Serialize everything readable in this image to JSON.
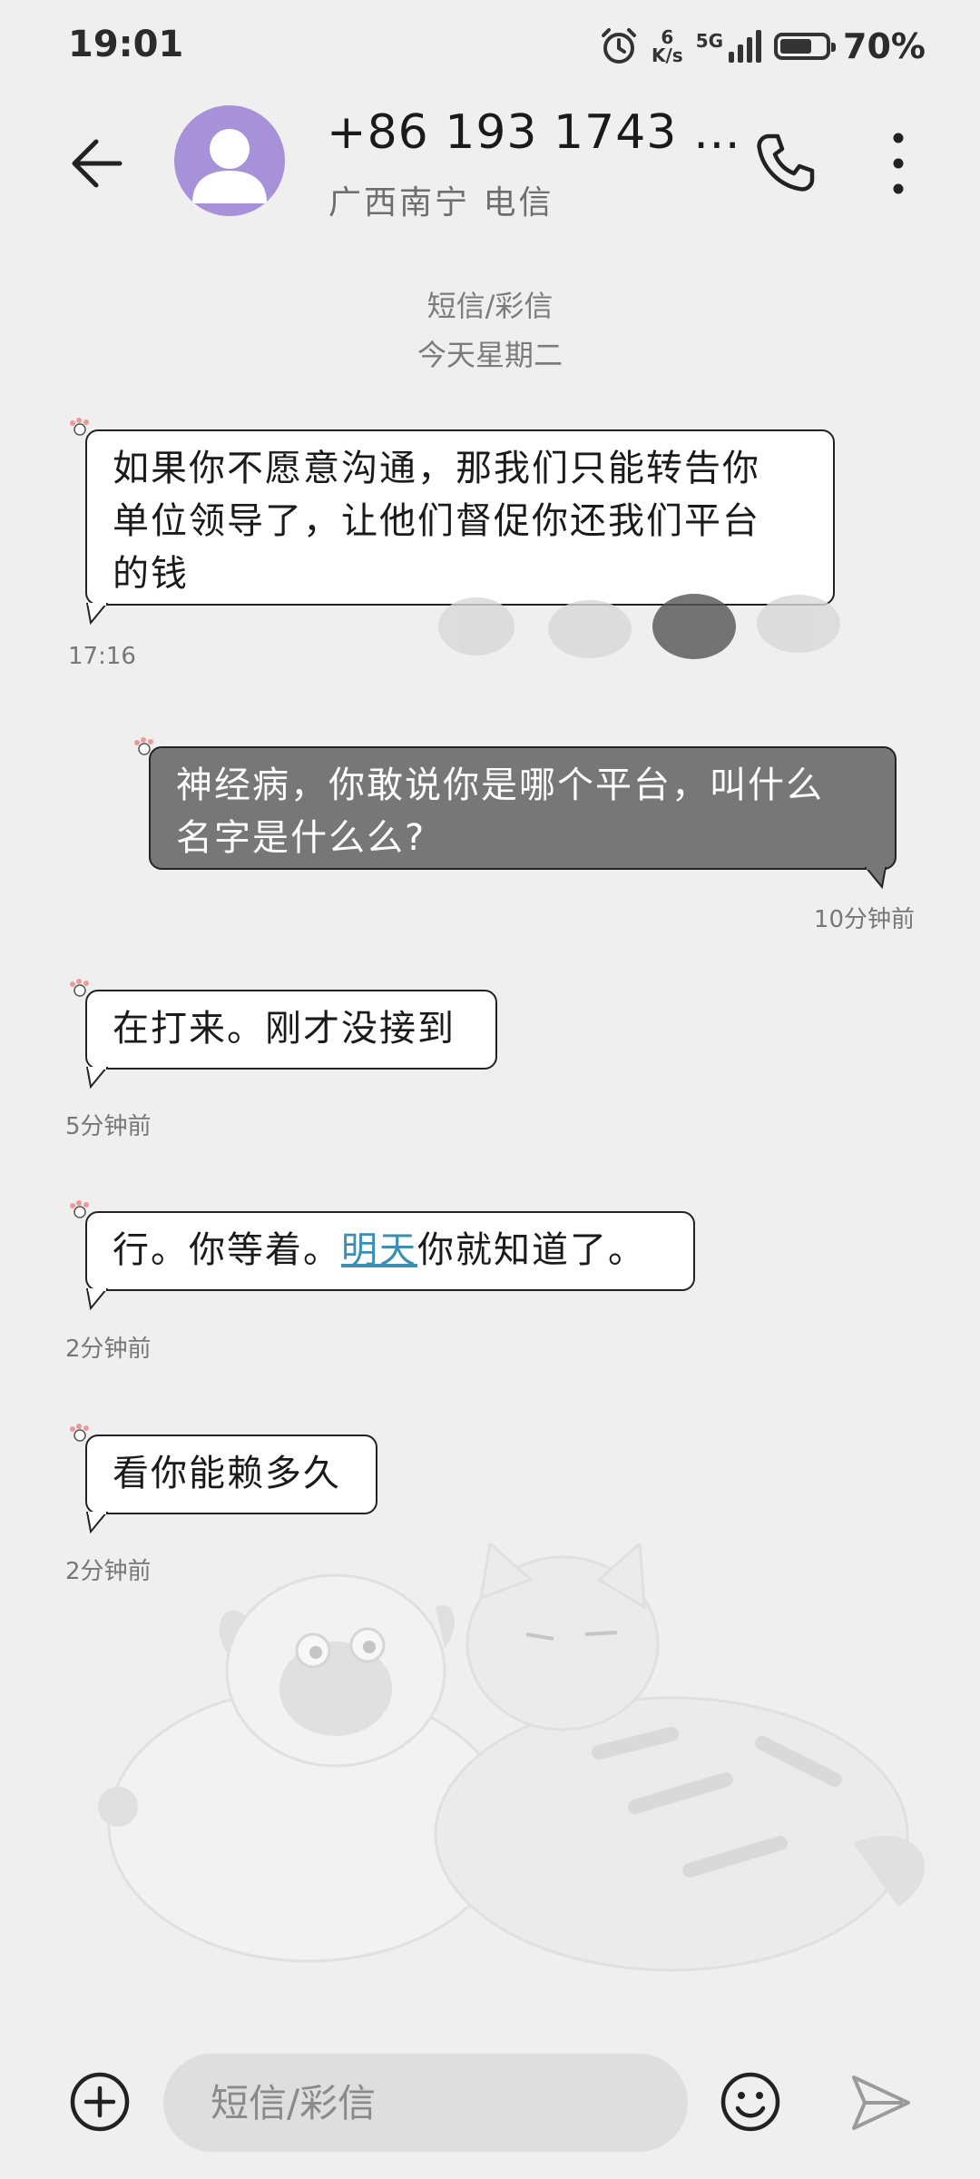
{
  "status_bar": {
    "time": "19:01",
    "net_speed_value": "6",
    "net_speed_unit": "K/s",
    "network": "5G",
    "battery_percent": "70%",
    "battery_level": 0.7
  },
  "header": {
    "contact_number": "+86 193 1743 …",
    "contact_location": "广西南宁 电信"
  },
  "thread": {
    "channel_label": "短信/彩信",
    "date_label": "今天星期二",
    "messages": [
      {
        "direction": "incoming",
        "lines": [
          "如果你不愿意沟通，那我们只能转告你",
          "单位领导了，让他们督促你还我们平台",
          "的钱"
        ],
        "time": "17:16"
      },
      {
        "direction": "outgoing",
        "lines": [
          "神经病，你敢说你是哪个平台，叫什么",
          "名字是什么么?"
        ],
        "time": "10分钟前"
      },
      {
        "direction": "incoming",
        "text": "在打来。刚才没接到",
        "time": "5分钟前"
      },
      {
        "direction": "incoming",
        "text_before": "行。你等着。",
        "link_text": "明天",
        "text_after": "你就知道了。",
        "time": "2分钟前"
      },
      {
        "direction": "incoming",
        "text": "看你能赖多久",
        "time": "2分钟前"
      }
    ]
  },
  "composer": {
    "placeholder": "短信/彩信"
  },
  "icons": {
    "back": "arrow-left-icon",
    "avatar": "person-icon",
    "call": "phone-icon",
    "more": "more-vertical-icon",
    "add": "plus-circle-icon",
    "emoji": "smiley-icon",
    "send": "send-icon",
    "alarm": "alarm-icon"
  },
  "colors": {
    "background": "#efefef",
    "avatar": "#a791d9",
    "outgoing_bubble": "#777777",
    "incoming_bubble": "#ffffff",
    "link": "#3a8fb3"
  }
}
